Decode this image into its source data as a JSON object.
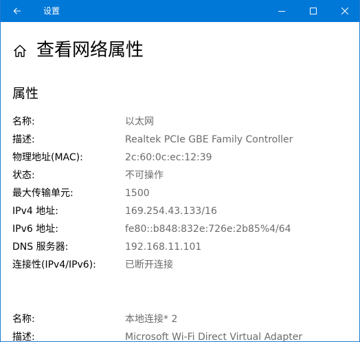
{
  "window": {
    "title": "设置"
  },
  "icons": {
    "back": "arrow-left-icon",
    "minimize": "minimize-icon",
    "maximize": "maximize-icon",
    "close": "close-icon",
    "home": "home-icon"
  },
  "page": {
    "title": "查看网络属性",
    "section_title": "属性"
  },
  "adapters": [
    {
      "properties": [
        {
          "label": "名称:",
          "value": "以太网"
        },
        {
          "label": "描述:",
          "value": "Realtek PCIe GBE Family Controller"
        },
        {
          "label": "物理地址(MAC):",
          "value": "2c:60:0c:ec:12:39"
        },
        {
          "label": "状态:",
          "value": "不可操作"
        },
        {
          "label": "最大传输单元:",
          "value": "1500"
        },
        {
          "label": "IPv4 地址:",
          "value": "169.254.43.133/16"
        },
        {
          "label": "IPv6 地址:",
          "value": "fe80::b848:832e:726e:2b85%4/64"
        },
        {
          "label": "DNS 服务器:",
          "value": "192.168.11.101"
        },
        {
          "label": "连接性(IPv4/IPv6):",
          "value": "已断开连接"
        }
      ]
    },
    {
      "properties": [
        {
          "label": "名称:",
          "value": "本地连接* 2"
        },
        {
          "label": "描述:",
          "value": "Microsoft Wi-Fi Direct Virtual Adapter"
        }
      ]
    }
  ]
}
